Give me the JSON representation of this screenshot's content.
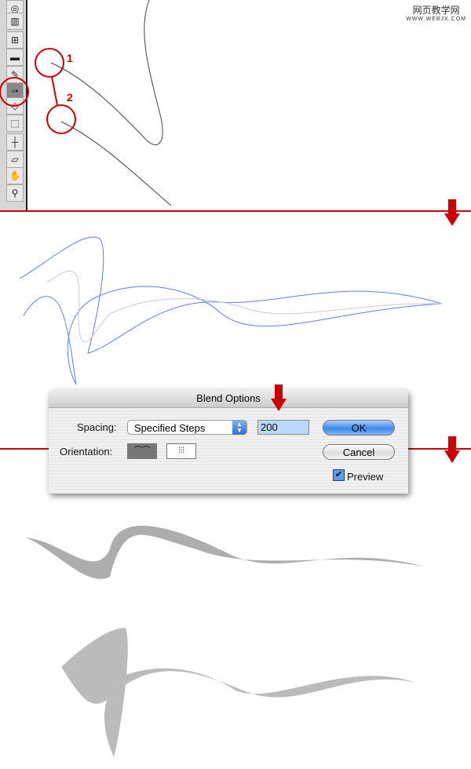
{
  "watermark": {
    "line1": "网页教学网",
    "line2": "WWW.WEBJX.COM"
  },
  "toolbar": {
    "tools": [
      "symbol-sprayer",
      "graph",
      "mesh",
      "gradient",
      "eyedropper",
      "blend",
      "live-paint",
      "selection",
      "slice",
      "eraser",
      "hand",
      "zoom"
    ],
    "selected": "blend"
  },
  "annotations": {
    "one": "1",
    "two": "2"
  },
  "colors": {
    "accent": "#cc0000",
    "path": "#5b7ff0",
    "ok_button": "#3f88e8"
  },
  "dialog": {
    "title": "Blend Options",
    "spacing_label": "Spacing:",
    "spacing_value": "Specified Steps",
    "steps_value": "200",
    "orientation_label": "Orientation:",
    "orientation_selected": "align-to-page",
    "ok": "OK",
    "cancel": "Cancel",
    "preview_label": "Preview",
    "preview_checked": true
  }
}
